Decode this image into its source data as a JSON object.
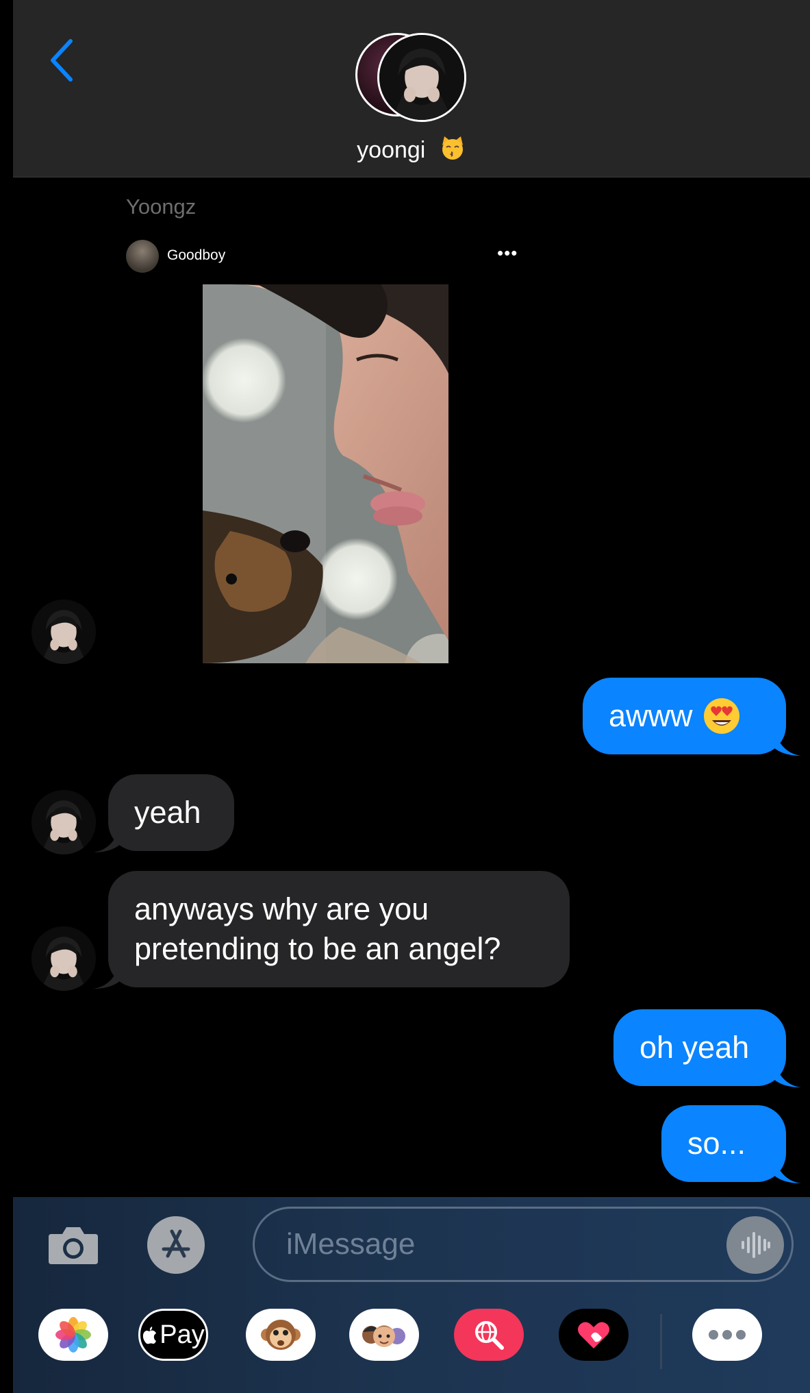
{
  "header": {
    "back_icon": "chevron-left-icon",
    "contact_name": "yoongi",
    "contact_emoji": "kissing-cat-face-icon"
  },
  "conversation": {
    "sender_label": "Yoongz",
    "shared_post": {
      "username": "Goodboy",
      "more_icon": "ellipsis-icon",
      "more_text": "•••"
    },
    "messages": [
      {
        "direction": "out",
        "text": "awww",
        "emoji": "heart-eyes-emoji"
      },
      {
        "direction": "in",
        "text": "yeah"
      },
      {
        "direction": "in",
        "text": "anyways why are you\npretending to be an angel?"
      },
      {
        "direction": "out",
        "text": "oh yeah"
      },
      {
        "direction": "out",
        "text": "so..."
      }
    ]
  },
  "input_bar": {
    "placeholder": "iMessage",
    "camera_icon": "camera-icon",
    "appstore_icon": "app-store-icon",
    "audio_icon": "audio-waveform-icon"
  },
  "app_drawer": [
    {
      "name": "photos",
      "icon": "photos-icon"
    },
    {
      "name": "apple-pay",
      "label": "Pay",
      "icon": "apple-pay-icon"
    },
    {
      "name": "animoji",
      "icon": "monkey-animoji-icon"
    },
    {
      "name": "memoji",
      "icon": "memoji-icon"
    },
    {
      "name": "images-search",
      "icon": "globe-search-icon"
    },
    {
      "name": "digital-touch",
      "icon": "heart-touch-icon"
    },
    {
      "name": "more-apps",
      "icon": "more-apps-icon"
    }
  ],
  "colors": {
    "outgoing_bubble": "#0a84ff",
    "incoming_bubble": "#262628",
    "header_bg": "#262626",
    "accent": "#0a84ff"
  }
}
